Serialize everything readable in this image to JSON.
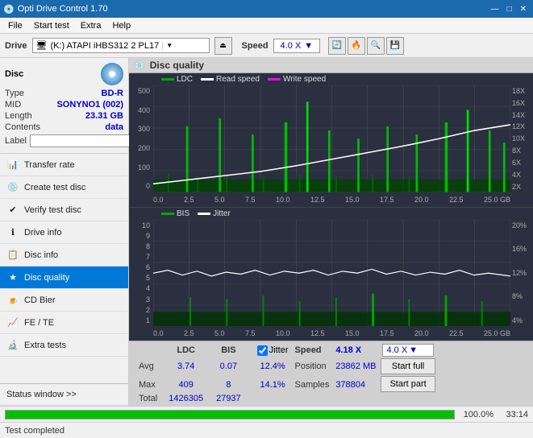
{
  "titleBar": {
    "title": "Opti Drive Control 1.70",
    "minimize": "—",
    "maximize": "□",
    "close": "✕"
  },
  "menuBar": {
    "items": [
      "File",
      "Start test",
      "Extra",
      "Help"
    ]
  },
  "driveBar": {
    "label": "Drive",
    "driveValue": "(K:)  ATAPI iHBS312  2 PL17",
    "speedLabel": "Speed",
    "speedValue": "4.0 X"
  },
  "disc": {
    "title": "Disc",
    "typeLabel": "Type",
    "typeValue": "BD-R",
    "midLabel": "MID",
    "midValue": "SONYNO1 (002)",
    "lengthLabel": "Length",
    "lengthValue": "23.31 GB",
    "contentsLabel": "Contents",
    "contentsValue": "data",
    "labelLabel": "Label",
    "labelValue": ""
  },
  "navItems": [
    {
      "id": "transfer-rate",
      "label": "Transfer rate",
      "icon": "📊"
    },
    {
      "id": "create-test-disc",
      "label": "Create test disc",
      "icon": "💿"
    },
    {
      "id": "verify-test-disc",
      "label": "Verify test disc",
      "icon": "✔"
    },
    {
      "id": "drive-info",
      "label": "Drive info",
      "icon": "ℹ"
    },
    {
      "id": "disc-info",
      "label": "Disc info",
      "icon": "📋"
    },
    {
      "id": "disc-quality",
      "label": "Disc quality",
      "icon": "★",
      "active": true
    },
    {
      "id": "cd-bier",
      "label": "CD Bier",
      "icon": "🍺"
    },
    {
      "id": "fe-te",
      "label": "FE / TE",
      "icon": "📈"
    },
    {
      "id": "extra-tests",
      "label": "Extra tests",
      "icon": "🔬"
    }
  ],
  "statusWindowLabel": "Status window >>",
  "chartPanel": {
    "title": "Disc quality",
    "icon": "💿",
    "legend1": {
      "ldc": "LDC",
      "readSpeed": "Read speed",
      "writeSpeed": "Write speed"
    },
    "legend2": {
      "bis": "BIS",
      "jitter": "Jitter"
    },
    "chart1": {
      "yMax": 500,
      "yAxisLabels": [
        "500",
        "400",
        "300",
        "200",
        "100",
        "0"
      ],
      "yAxisRight": [
        "18X",
        "16X",
        "14X",
        "12X",
        "10X",
        "8X",
        "6X",
        "4X",
        "2X"
      ],
      "xAxisLabels": [
        "0.0",
        "2.5",
        "5.0",
        "7.5",
        "10.0",
        "12.5",
        "15.0",
        "17.5",
        "20.0",
        "22.5",
        "25.0"
      ]
    },
    "chart2": {
      "yMax": 10,
      "yAxisLabels": [
        "10",
        "9",
        "8",
        "7",
        "6",
        "5",
        "4",
        "3",
        "2",
        "1"
      ],
      "yAxisRight": [
        "20%",
        "16%",
        "12%",
        "8%",
        "4%"
      ],
      "xAxisLabels": [
        "0.0",
        "2.5",
        "5.0",
        "7.5",
        "10.0",
        "12.5",
        "15.0",
        "17.5",
        "20.0",
        "22.5",
        "25.0"
      ]
    }
  },
  "statsPanel": {
    "ldcLabel": "LDC",
    "bisLabel": "BIS",
    "jitterLabel": "Jitter",
    "jitterChecked": true,
    "speedLabel": "Speed",
    "speedValue": "4.18 X",
    "speedComboValue": "4.0 X",
    "positionLabel": "Position",
    "positionValue": "23862 MB",
    "samplesLabel": "Samples",
    "samplesValue": "378804",
    "avgLabel": "Avg",
    "avgLDC": "3.74",
    "avgBIS": "0.07",
    "avgJitter": "12.4%",
    "maxLabel": "Max",
    "maxLDC": "409",
    "maxBIS": "8",
    "maxJitter": "14.1%",
    "totalLabel": "Total",
    "totalLDC": "1426305",
    "totalBIS": "27937",
    "startFullLabel": "Start full",
    "startPartLabel": "Start part"
  },
  "progressBar": {
    "percent": 100,
    "percentText": "100.0%",
    "time": "33:14"
  },
  "statusBar": {
    "text": "Test completed"
  }
}
